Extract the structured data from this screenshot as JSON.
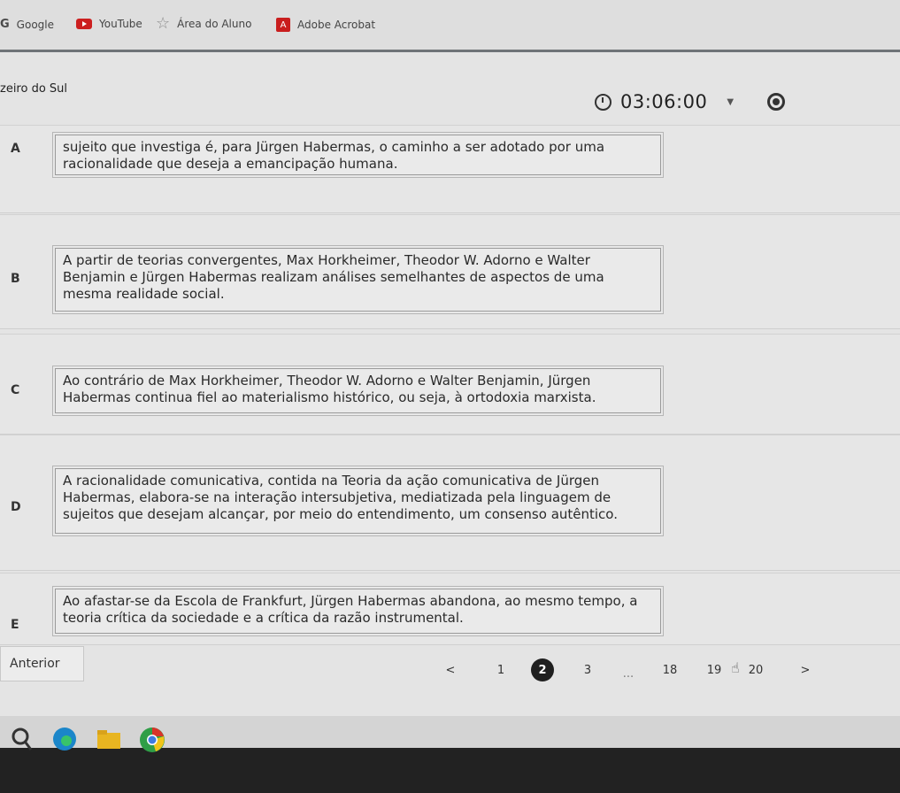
{
  "bookmarks": [
    {
      "label": "Google",
      "icon": "google-g-icon"
    },
    {
      "label": "YouTube",
      "icon": "youtube-icon"
    },
    {
      "label": "Área do Aluno",
      "icon": "star-icon"
    },
    {
      "label": "Adobe Acrobat",
      "icon": "acrobat-icon"
    }
  ],
  "header": {
    "subject": "zeiro do Sul",
    "timer": "03:06:00"
  },
  "options": [
    {
      "letter": "A",
      "text": "sujeito que investiga é, para Jürgen Habermas, o caminho a ser adotado por uma racionalidade que deseja a emancipação humana."
    },
    {
      "letter": "B",
      "text": "A partir de teorias convergentes, Max Horkheimer, Theodor W. Adorno e Walter Benjamin e Jürgen Habermas realizam análises semelhantes de aspectos de uma mesma realidade social."
    },
    {
      "letter": "C",
      "text": "Ao contrário de Max Horkheimer, Theodor W. Adorno e Walter Benjamin, Jürgen Habermas continua fiel ao materialismo histórico, ou seja, à ortodoxia marxista."
    },
    {
      "letter": "D",
      "text": "A racionalidade comunicativa, contida na Teoria da ação comunicativa de Jürgen Habermas, elabora-se na interação intersubjetiva, mediatizada pela linguagem de sujeitos que desejam alcançar, por meio do entendimento, um consenso autêntico."
    },
    {
      "letter": "E",
      "text": "Ao afastar-se da Escola de Frankfurt, Jürgen Habermas abandona, ao mesmo tempo, a teoria crítica da sociedade e a crítica da razão instrumental."
    }
  ],
  "navigation": {
    "prev_label": "Anterior",
    "prev_arrow": "<",
    "next_arrow": ">",
    "ellipsis": "...",
    "pages": [
      "1",
      "2",
      "3",
      "18",
      "19",
      "20"
    ],
    "current_page": "2"
  },
  "taskbar": [
    "search-icon",
    "edge-icon",
    "file-explorer-icon",
    "chrome-icon"
  ]
}
